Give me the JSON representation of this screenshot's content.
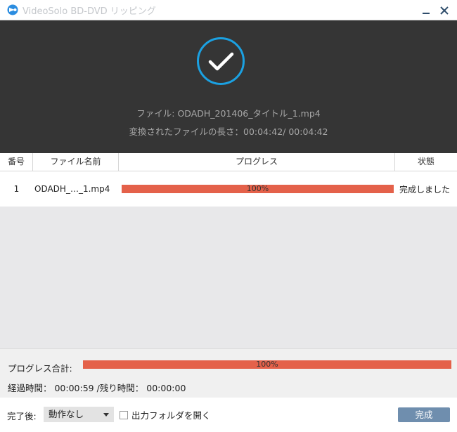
{
  "window": {
    "title": "VideoSolo BD-DVD リッピング",
    "icons": {
      "app": "disc-logo-icon",
      "minimize": "minimize-icon",
      "close": "close-icon"
    }
  },
  "hero": {
    "status_icon": "checkmark-circle-icon",
    "file_line": "ファイル: ODADH_201406_タイトル_1.mp4",
    "length_line": "変換されたファイルの長さ：00:04:42/ 00:04:42"
  },
  "table": {
    "headers": {
      "num": "番号",
      "name": "ファイル名前",
      "progress": "プログレス",
      "state": "状態"
    },
    "rows": [
      {
        "num": "1",
        "name": "ODADH_…_1.mp4",
        "progress_text": "100%",
        "progress": 1.0,
        "state": "完成しました"
      }
    ]
  },
  "summary": {
    "total_label": "プログレス合計:",
    "total_text": "100%",
    "total_progress": 1.0,
    "elapsed_line": "経過時間： 00:00:59 /残り時間： 00:00:00"
  },
  "footer": {
    "after_label": "完了後:",
    "after_value": "動作なし",
    "open_folder_label": "出力フォルダを開く",
    "open_folder_checked": false,
    "done_label": "完成"
  },
  "colors": {
    "progress": "#e4614a",
    "hero_bg": "#353535",
    "check_ring": "#1ba1e2",
    "done_button": "#6f8eae"
  }
}
